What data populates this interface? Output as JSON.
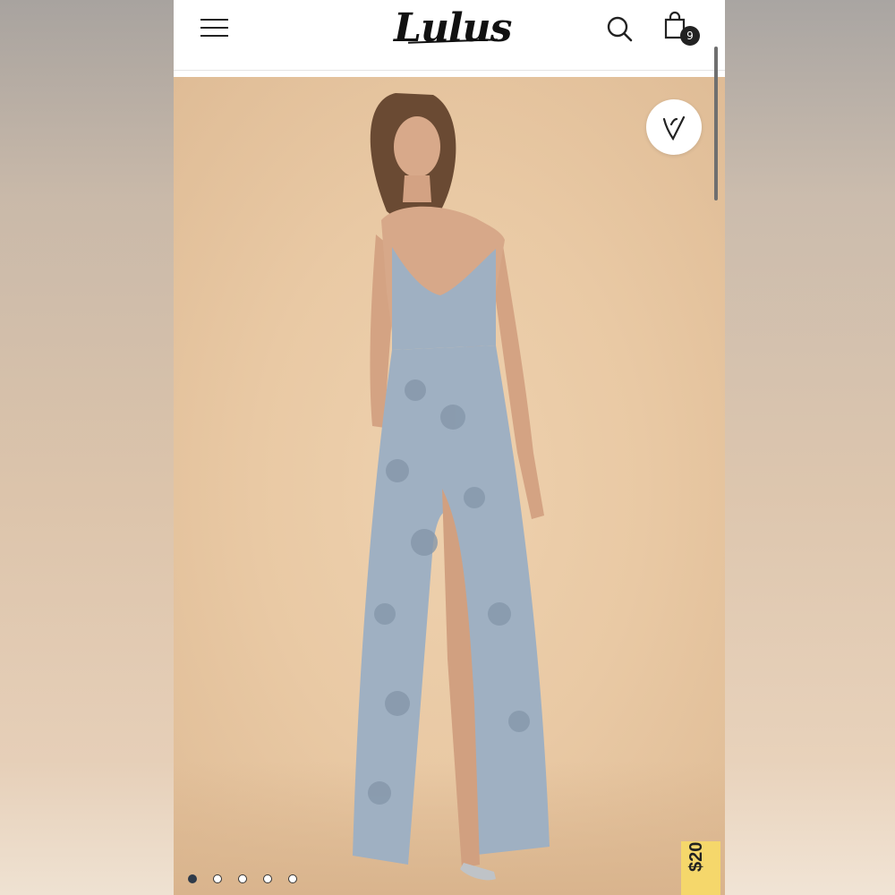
{
  "header": {
    "logo_text": "Lulus",
    "cart_count": "9"
  },
  "product_gallery": {
    "image_subject": "model-wearing-blue-floral-jacquard-satin-maxi-dress",
    "current_slide": 1,
    "slide_count": 5
  },
  "promo_tab": {
    "label": "$20!"
  },
  "colors": {
    "dress": "#9fb0c2",
    "background": "#e9c9a4",
    "badge": "#222222",
    "promo": "#f5d76b"
  },
  "icons": [
    "menu-icon",
    "search-icon",
    "shopping-bag-icon",
    "heart-icon"
  ]
}
